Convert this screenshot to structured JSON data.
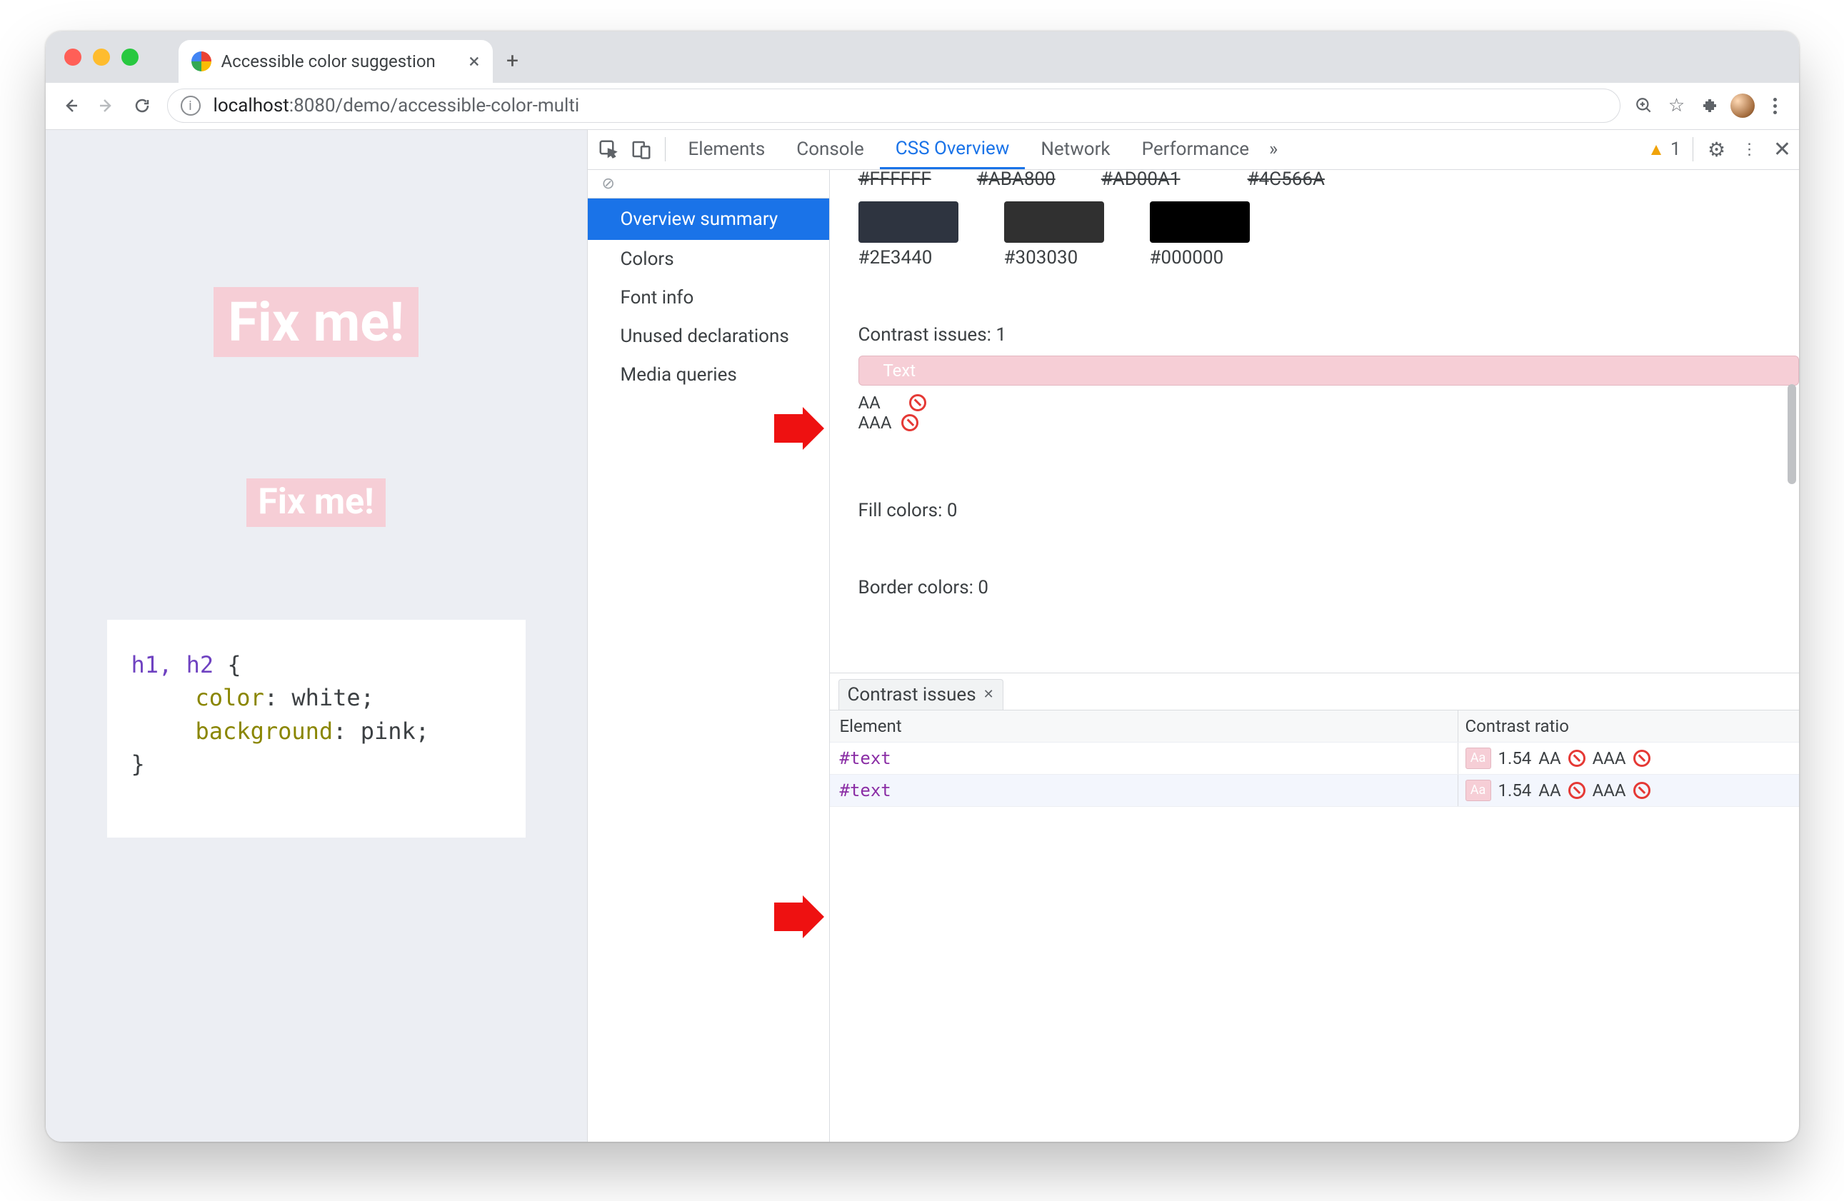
{
  "browser": {
    "traffic": [
      "close",
      "minimize",
      "zoom"
    ],
    "tab_title": "Accessible color suggestion",
    "newtab_glyph": "+",
    "nav": {
      "back": "←",
      "forward": "→",
      "reload": "↻"
    },
    "omnibox_info_glyph": "i",
    "url_host": "localhost",
    "url_rest": ":8080/demo/accessible-color-multi",
    "icons": {
      "zoom": "⊕",
      "star": "☆",
      "extensions": "✦",
      "kebab": "⋮"
    }
  },
  "page": {
    "h1": "Fix me!",
    "h2": "Fix me!",
    "code": {
      "selector": "h1, h2",
      "open": " {",
      "rule1_prop": "color",
      "rule1_val": "white",
      "rule2_prop": "background",
      "rule2_val": "pink",
      "close": "}"
    }
  },
  "devtools": {
    "tabs": [
      "Elements",
      "Console",
      "CSS Overview",
      "Network",
      "Performance"
    ],
    "active_tab": "CSS Overview",
    "more_glyph": "»",
    "warning_count": 1,
    "gear_glyph": "⚙",
    "kebab_glyph": "⋮",
    "close_glyph": "✕",
    "sidebar": {
      "clear_glyph": "⊘",
      "items": [
        "Overview summary",
        "Colors",
        "Font info",
        "Unused declarations",
        "Media queries"
      ],
      "selected_index": 0
    },
    "colors_top_labels": [
      "#FFFFFF",
      "#ABA800",
      "#AD00A1",
      "#4C566A"
    ],
    "colors_row2": [
      {
        "label": "#2E3440",
        "hex": "#2E3440"
      },
      {
        "label": "#303030",
        "hex": "#303030"
      },
      {
        "label": "#000000",
        "hex": "#000000"
      }
    ],
    "contrast_heading": "Contrast issues: 1",
    "text_swatch_label": "Text",
    "aa_label": "AA",
    "aaa_label": "AAA",
    "fill_heading": "Fill colors: 0",
    "border_heading": "Border colors: 0",
    "bottom_tab": "Contrast issues",
    "bottom_tab_close": "✕",
    "col_element": "Element",
    "col_ratio": "Contrast ratio",
    "rows": [
      {
        "el": "#text",
        "sw": "Aa",
        "ratio": "1.54",
        "aa": "AA",
        "aaa": "AAA"
      },
      {
        "el": "#text",
        "sw": "Aa",
        "ratio": "1.54",
        "aa": "AA",
        "aaa": "AAA"
      }
    ]
  }
}
